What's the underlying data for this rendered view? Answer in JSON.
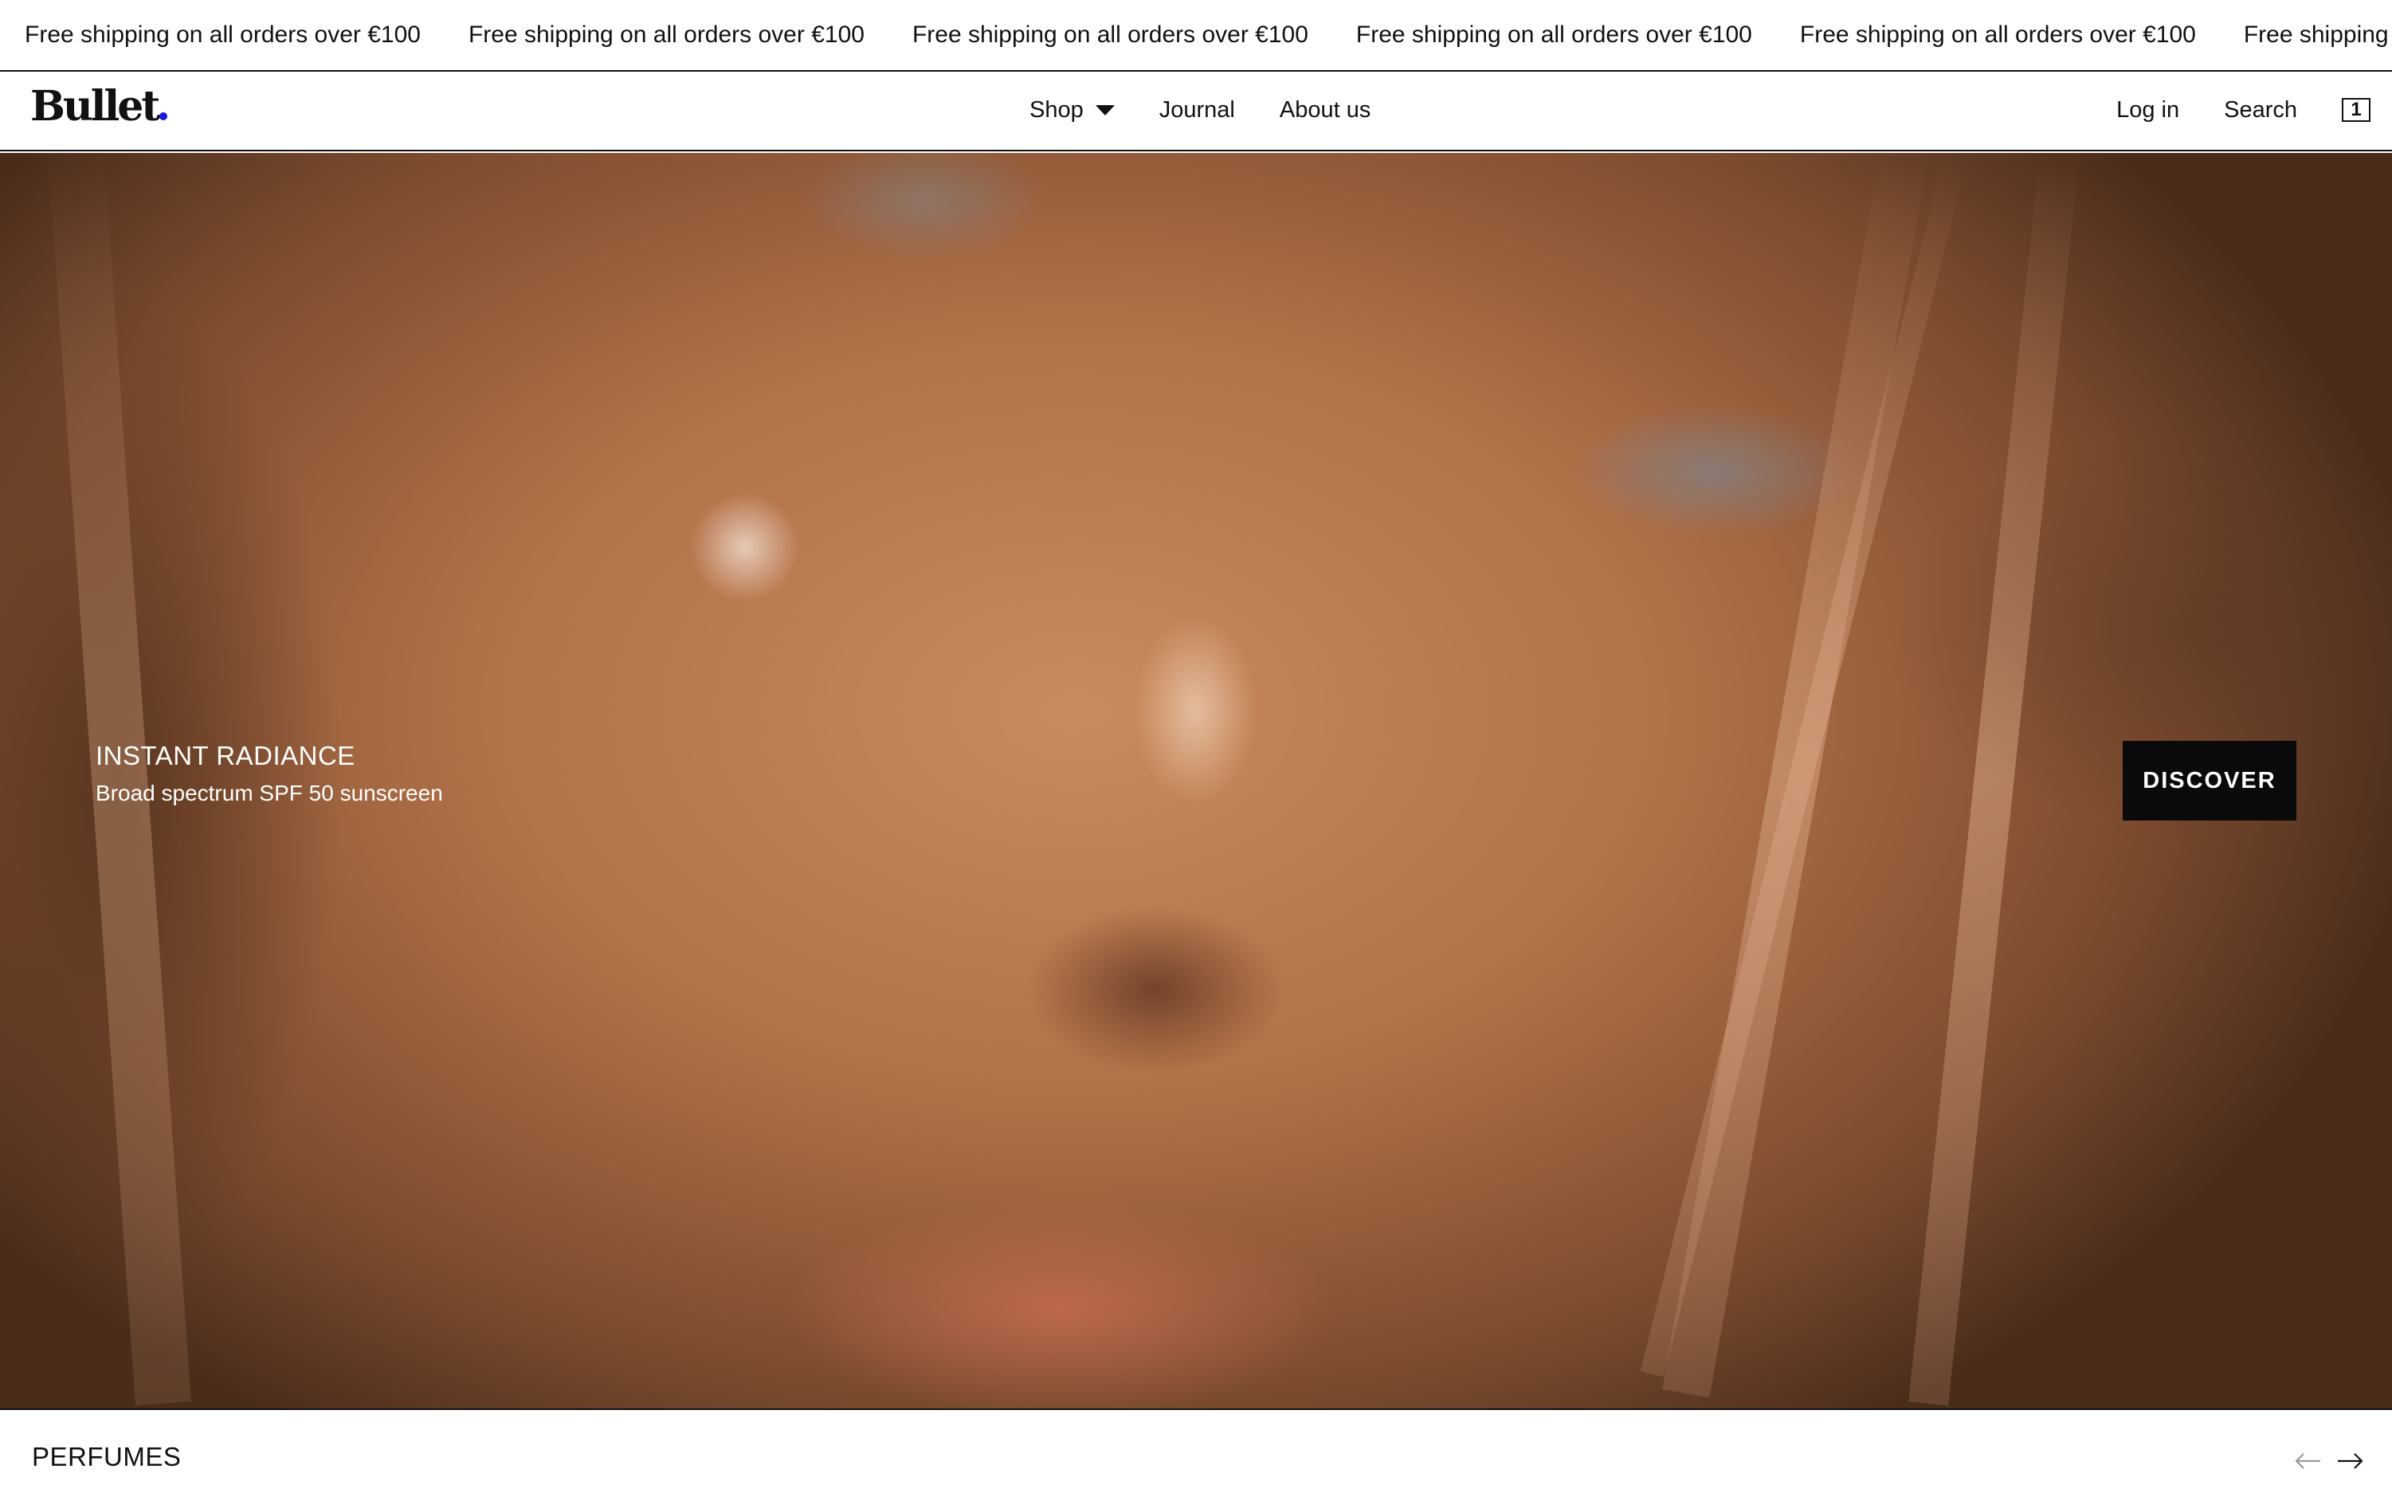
{
  "announcement": {
    "items": [
      "Free shipping on all orders over €100",
      "Free shipping on all orders over €100",
      "Free shipping on all orders over €100",
      "Free shipping on all orders over €100",
      "Free shipping on all orders over €100",
      "Free shipping on all orders over €100"
    ]
  },
  "header": {
    "logo_text": "Bullet",
    "logo_dot_color": "#1a1adb",
    "nav": {
      "shop": "Shop",
      "journal": "Journal",
      "about": "About us"
    },
    "account": {
      "login": "Log in",
      "search": "Search",
      "cart_count": "1"
    }
  },
  "hero": {
    "title": "INSTANT RADIANCE",
    "subtitle": "Broad spectrum SPF 50 sunscreen",
    "cta_label": "DISCOVER"
  },
  "collection": {
    "title": "PERFUMES",
    "prev_icon": "arrow-left-icon",
    "next_icon": "arrow-right-icon"
  }
}
